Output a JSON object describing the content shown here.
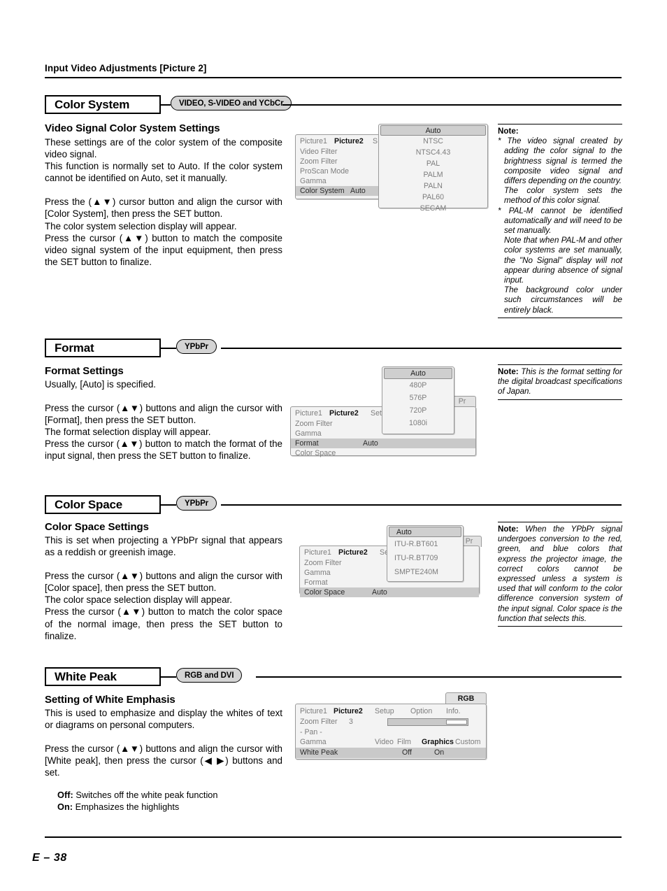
{
  "running_head": "Input Video Adjustments [Picture 2]",
  "footer": {
    "page_label": "E – 38"
  },
  "sections": [
    {
      "title": "Color System",
      "badge": "VIDEO, S-VIDEO and YCbCr",
      "subtitle": "Video Signal Color System Settings",
      "paragraphs": [
        "These settings are of the color system of the composite video signal.",
        "This function is normally set to Auto. If the color system cannot be identified on Auto, set it manually.",
        "Press the (▲▼) cursor button and align the cursor with [Color System], then press the SET button.",
        "The color system selection display will appear.",
        "Press the cursor (▲▼) button to match the composite video signal system of the input equipment, then press the SET button to finalize."
      ],
      "note": {
        "label": "Note:",
        "items": [
          "* The video signal created by adding the color signal to the brightness signal is termed the composite video signal and differs depending on the country.",
          "The color system sets the method of this color signal.",
          "* PAL-M cannot be identified automatically and will need to be set manually.",
          "Note that when PAL-M and other color systems are set manually, the \"No Signal\" display will not appear during absence of signal input.",
          "The background color under such circumstances will be entirely black."
        ]
      },
      "osd": {
        "tabs": [
          "Picture1",
          "Picture2",
          "S"
        ],
        "active_tab": "Picture2",
        "rows": [
          {
            "label": "Video Filter",
            "value": ""
          },
          {
            "label": "Zoom Filter",
            "value": ""
          },
          {
            "label": "ProScan Mode",
            "value": ""
          },
          {
            "label": "Gamma",
            "value": ""
          },
          {
            "label": "Color System",
            "value": "Auto",
            "selected": true
          }
        ],
        "dropdown": {
          "items": [
            "Auto",
            "NTSC",
            "NTSC4.43",
            "PAL",
            "PALM",
            "PALN",
            "PAL60",
            "SECAM"
          ],
          "selected": "Auto"
        }
      }
    },
    {
      "title": "Format",
      "badge": "YPbPr",
      "subtitle": "Format Settings",
      "paragraphs": [
        "Usually, [Auto] is specified.",
        "Press the cursor (▲▼) buttons and align the cursor with [Format], then press the SET button.",
        "The format selection display will appear.",
        "Press the cursor (▲▼) button to match the format of the input signal, then press the SET button to finalize."
      ],
      "note": {
        "label": "Note:",
        "text": "This is the format setting for the digital broadcast specifications of Japan."
      },
      "osd": {
        "tabs": [
          "Picture1",
          "Picture2",
          "Setup"
        ],
        "active_tab": "Picture2",
        "corner_tab": "Pr",
        "rows": [
          {
            "label": "Zoom Filter",
            "value": ""
          },
          {
            "label": "Gamma",
            "value": ""
          },
          {
            "label": "Format",
            "value": "Auto",
            "selected": true
          },
          {
            "label": "Color Space",
            "value": ""
          }
        ],
        "dropdown": {
          "items": [
            "Auto",
            "480P",
            "576P",
            "720P",
            "1080i"
          ],
          "selected": "Auto"
        }
      }
    },
    {
      "title": "Color Space",
      "badge": "YPbPr",
      "subtitle": "Color Space Settings",
      "paragraphs": [
        "This is set when projecting a YPbPr signal that appears as a reddish or greenish image.",
        "Press the cursor (▲▼) buttons and align the cursor with [Color space], then press the SET button.",
        "The color space selection display will appear.",
        "Press the cursor (▲▼) button to match the color space of the normal image, then press the SET button to finalize."
      ],
      "note": {
        "label": "Note:",
        "text": "When the YPbPr signal undergoes conversion to the red, green, and blue colors that express the projector image, the correct colors cannot be expressed unless a system is used that will conform to the color difference conversion system of the input signal. Color space is the function that selects this."
      },
      "osd": {
        "tabs": [
          "Picture1",
          "Picture2",
          "Setu"
        ],
        "active_tab": "Picture2",
        "corner_tab": "Pr",
        "rows": [
          {
            "label": "Zoom Filter",
            "value": ""
          },
          {
            "label": "Gamma",
            "value": ""
          },
          {
            "label": "Format",
            "value": ""
          },
          {
            "label": "Color Space",
            "value": "Auto",
            "selected": true
          }
        ],
        "dropdown": {
          "items": [
            "Auto",
            "ITU-R.BT601",
            "ITU-R.BT709",
            "SMPTE240M"
          ],
          "selected": "Auto"
        }
      }
    },
    {
      "title": "White Peak",
      "badge": "RGB and DVI",
      "subtitle": "Setting of White Emphasis",
      "paragraphs": [
        "This is used to emphasize and display the whites of text or diagrams on personal computers.",
        "Press the cursor (▲▼) buttons and align the cursor with [White peak], then press the cursor (◀ ▶) buttons and set."
      ],
      "definitions": [
        {
          "term": "Off:",
          "desc": "Switches off the white peak function"
        },
        {
          "term": "On:",
          "desc": "Emphasizes the highlights"
        }
      ],
      "osd": {
        "tabs": [
          "Picture1",
          "Picture2",
          "Setup",
          "Option",
          "Info."
        ],
        "active_tab": "Picture2",
        "corner_tab": "RGB",
        "rows": [
          {
            "label": "Zoom Filter",
            "value": "3",
            "slider": true
          },
          {
            "label": "- Pan -",
            "value": ""
          },
          {
            "label": "Gamma",
            "options": [
              "Video",
              "Film",
              "Graphics",
              "Custom"
            ],
            "selected_option": "Graphics"
          },
          {
            "label": "White Peak",
            "options": [
              "Off",
              "On"
            ],
            "selected": true
          }
        ]
      }
    }
  ]
}
